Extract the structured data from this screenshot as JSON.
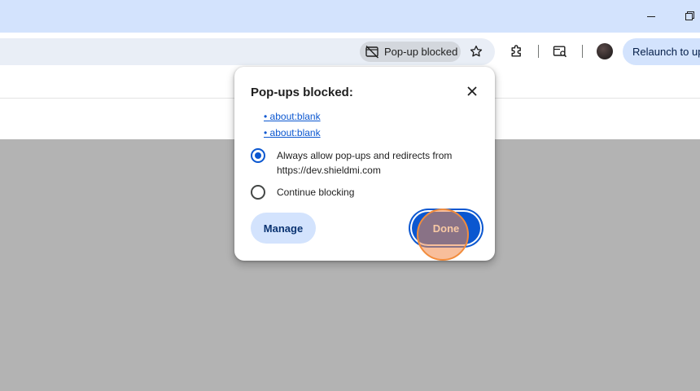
{
  "window": {
    "minimize_icon": "minimize-icon",
    "maximize_icon": "restore-icon"
  },
  "toolbar": {
    "popup_chip_label": "Pop-up blocked",
    "popup_chip_icon": "popup-blocked-icon",
    "star_icon": "bookmark-star-icon",
    "extensions_icon": "puzzle-icon",
    "search_tabs_icon": "tab-search-icon",
    "relaunch_label": "Relaunch to update"
  },
  "bubble": {
    "title": "Pop-ups blocked:",
    "links": [
      "about:blank",
      "about:blank"
    ],
    "options": [
      {
        "label": "Always allow pop-ups and redirects from https://dev.shieldmi.com",
        "checked": true
      },
      {
        "label": "Continue blocking",
        "checked": false
      }
    ],
    "manage_label": "Manage",
    "done_label": "Done"
  },
  "colors": {
    "titlebar": "#d3e3fd",
    "accent": "#0b57d0",
    "page_gray": "#b3b3b3",
    "click_marker": "#f28c3c"
  }
}
